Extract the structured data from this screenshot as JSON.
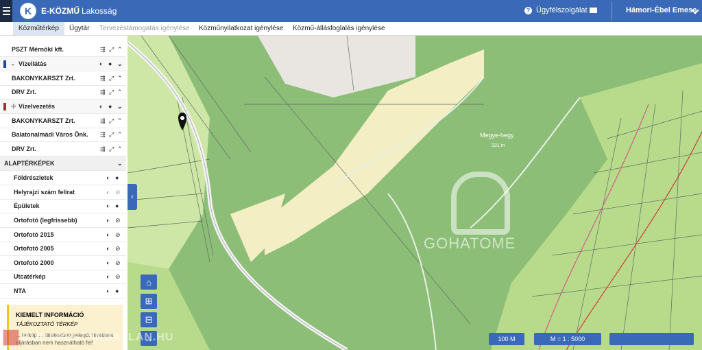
{
  "header": {
    "logo_letter": "K",
    "app_name": "E-KÖZMŰ",
    "app_subtitle": "Lakosság",
    "support_label": "Ügyfélszolgálat",
    "user_name": "Hámori-Ébel Emese"
  },
  "tabs": [
    {
      "label": "Közműtérkép",
      "active": true
    },
    {
      "label": "Ügytár",
      "active": false
    },
    {
      "label": "Tervezéstámogatás igénylése",
      "active": false,
      "disabled": true
    },
    {
      "label": "Közműnyilatkozat igénylése",
      "active": false
    },
    {
      "label": "Közmű-állásfoglalás igénylése",
      "active": false
    }
  ],
  "sidebar": {
    "layers": [
      {
        "label": "PSZT Mérnöki kft.",
        "kind": "provider"
      },
      {
        "label": "Vízellátás",
        "kind": "group",
        "color": "#1f3fb0",
        "icon": "water-drop-icon"
      },
      {
        "label": "BAKONYKARSZT Zrt.",
        "kind": "provider"
      },
      {
        "label": "DRV Zrt.",
        "kind": "provider"
      },
      {
        "label": "Vízelvezetés",
        "kind": "group",
        "color": "#a0302d",
        "icon": "drain-icon"
      },
      {
        "label": "BAKONYKARSZT Zrt.",
        "kind": "provider"
      },
      {
        "label": "Balatonalmádi Város Önk.",
        "kind": "provider"
      },
      {
        "label": "DRV Zrt.",
        "kind": "provider"
      }
    ],
    "basemaps_title": "ALAPTÉRKÉPEK",
    "basemaps": [
      {
        "label": "Földrészletek",
        "visible": true
      },
      {
        "label": "Helyrajzi szám felirat",
        "visible": false
      },
      {
        "label": "Épületek",
        "visible": true
      },
      {
        "label": "Ortofotó (legfrissebb)",
        "visible": false
      },
      {
        "label": "Ortofotó 2015",
        "visible": false
      },
      {
        "label": "Ortofotó 2005",
        "visible": false
      },
      {
        "label": "Ortofotó 2000",
        "visible": false
      },
      {
        "label": "Utcatérkép",
        "visible": false
      },
      {
        "label": "NTA",
        "visible": true
      }
    ],
    "info": {
      "title": "KIEMELT INFORMÁCIÓ",
      "subtitle": "TÁJÉKOZTATÓ TÉRKÉP",
      "line1": "... térkép ... tájékoztató jellegű, hivatalos",
      "line2": "eljárásban nem használható fel!"
    }
  },
  "map": {
    "hill_name": "Megye-hegy",
    "hill_elevation": "331 m",
    "watermark": "GOHATOME",
    "bottom_watermark": "BUDAPEST-INGATLAN.HU",
    "scale_label": "100 M",
    "ratio_label": "M = 1 : 5000",
    "colors": {
      "forest": "#8dbe78",
      "field": "#b7db8a",
      "clearing": "#f5f0c8",
      "urban": "#e9e6e2"
    }
  }
}
